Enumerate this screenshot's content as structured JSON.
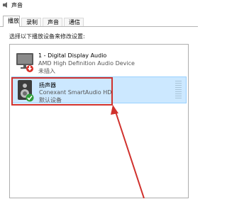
{
  "window": {
    "title": "声音"
  },
  "tabs": [
    {
      "label": "播放",
      "active": true
    },
    {
      "label": "录制",
      "active": false
    },
    {
      "label": "声音",
      "active": false
    },
    {
      "label": "通信",
      "active": false
    }
  ],
  "instruction": "选择以下播放设备来修改设置:",
  "devices": [
    {
      "name": "1 - Digital Display Audio",
      "description": "AMD High Definition Audio Device",
      "status": "未插入",
      "icon": "monitor-speaker-icon",
      "status_icon": "unplugged-arrow-icon",
      "selected": false
    },
    {
      "name": "扬声器",
      "description": "Conexant SmartAudio HD",
      "status": "默认设备",
      "icon": "speaker-icon",
      "status_icon": "default-check-icon",
      "selected": true
    }
  ],
  "colors": {
    "selection_bg": "#cce8ff",
    "selection_border": "#99d1ff",
    "annotation_red": "#d0312d",
    "default_check_green": "#2e9e3a",
    "unplugged_red": "#d9322a"
  }
}
